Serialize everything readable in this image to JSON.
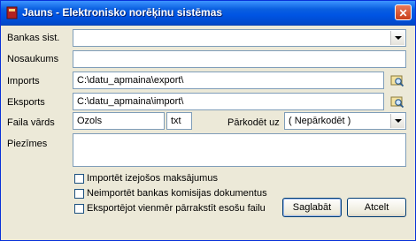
{
  "window": {
    "title": "Jauns - Elektronisko norēķinu sistēmas",
    "close_label": "✕"
  },
  "form": {
    "bank_system": {
      "label": "Bankas sist.",
      "value": ""
    },
    "name": {
      "label": "Nosaukums",
      "value": ""
    },
    "import": {
      "label": "Imports",
      "value": "C:\\datu_apmaina\\export\\"
    },
    "export": {
      "label": "Eksports",
      "value": "C:\\datu_apmaina\\import\\"
    },
    "file_name": {
      "label": "Faila vārds",
      "value": "Ozols",
      "extension": "txt"
    },
    "recode": {
      "label": "Pārkodēt uz",
      "value": "( Nepārkodēt )"
    },
    "notes": {
      "label": "Piezīmes",
      "value": ""
    }
  },
  "options": [
    {
      "label": "Importēt izejošos maksājumus",
      "checked": false
    },
    {
      "label": "Neimportēt bankas komisijas dokumentus",
      "checked": false
    },
    {
      "label": "Eksportējot vienmēr pārrakstīt esošu failu",
      "checked": false
    }
  ],
  "buttons": {
    "save": "Saglabāt",
    "cancel": "Atcelt"
  },
  "icons": {
    "app": "book-icon",
    "browse": "folder-search-icon"
  }
}
